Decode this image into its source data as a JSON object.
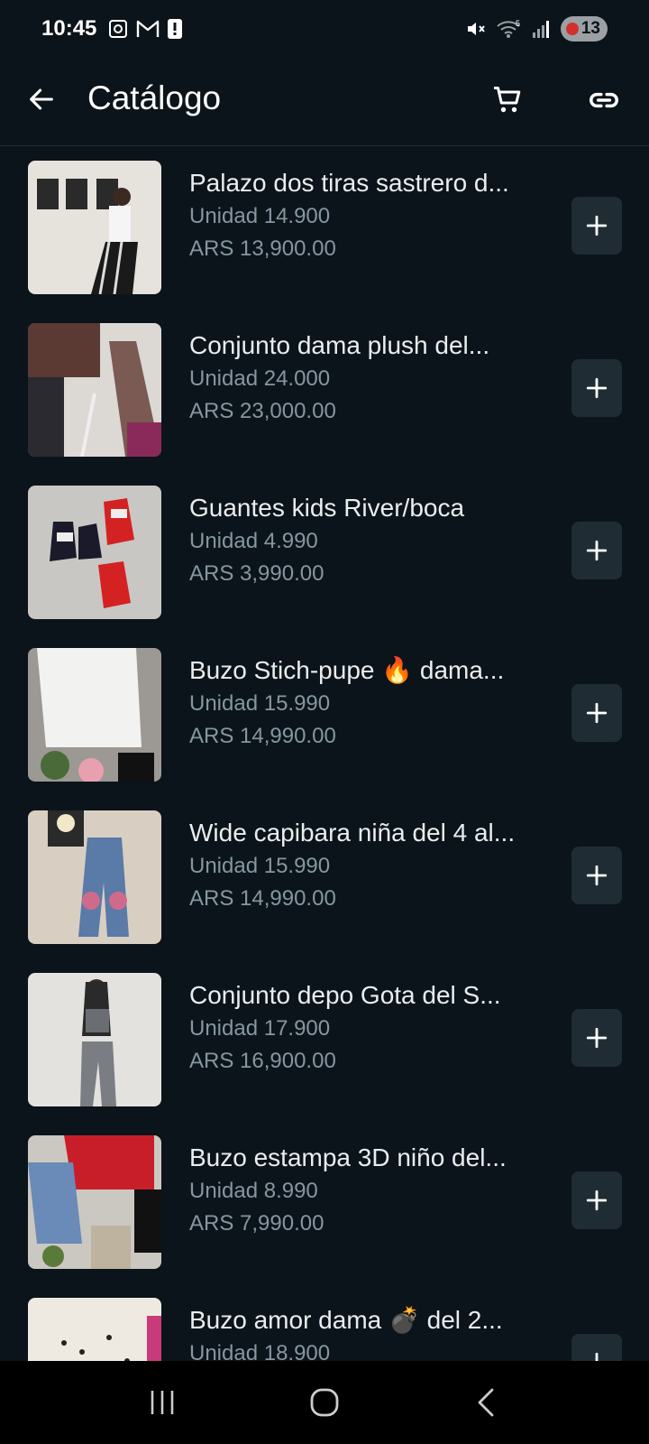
{
  "status_bar": {
    "time": "10:45",
    "battery": "13",
    "signal_label": "5"
  },
  "app_bar": {
    "title": "Catálogo"
  },
  "items": [
    {
      "title": "Palazo dos tiras sastrero d...",
      "desc": "Unidad 14.900",
      "price": "ARS 13,900.00"
    },
    {
      "title": "Conjunto dama plush del...",
      "desc": "Unidad 24.000",
      "price": "ARS 23,000.00"
    },
    {
      "title": "Guantes kids River/boca",
      "desc": "Unidad 4.990",
      "price": "ARS 3,990.00"
    },
    {
      "title": "Buzo Stich-pupe 🔥 dama...",
      "desc": "Unidad 15.990",
      "price": "ARS 14,990.00"
    },
    {
      "title": "Wide capibara niña del 4 al...",
      "desc": "Unidad 15.990",
      "price": "ARS 14,990.00"
    },
    {
      "title": "Conjunto depo Gota del S...",
      "desc": "Unidad 17.900",
      "price": "ARS 16,900.00"
    },
    {
      "title": "Buzo estampa 3D niño del...",
      "desc": "Unidad 8.990",
      "price": "ARS 7,990.00"
    },
    {
      "title": "Buzo amor dama 💣 del 2...",
      "desc": "Unidad 18.900",
      "price": ""
    }
  ],
  "colors": {
    "background": "#0b141a",
    "button_bg": "#202c33",
    "secondary_text": "#8696a0"
  }
}
